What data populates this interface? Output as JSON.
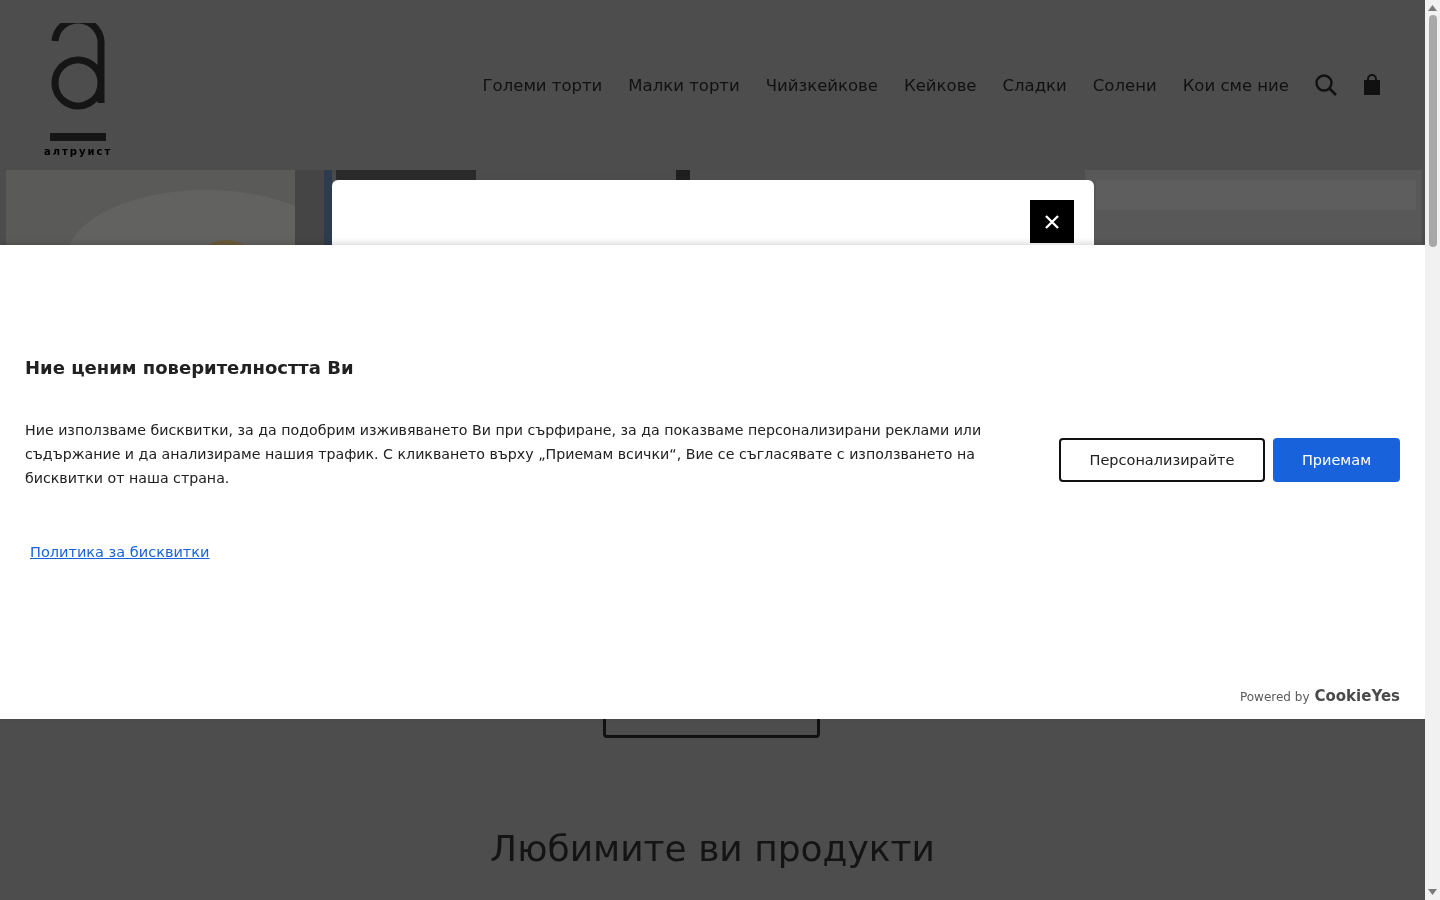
{
  "header": {
    "logo_text": "алтруист",
    "nav": [
      {
        "label": "Големи торти"
      },
      {
        "label": "Малки торти"
      },
      {
        "label": "Чийзкейкове"
      },
      {
        "label": "Кейкове"
      },
      {
        "label": "Сладки"
      },
      {
        "label": "Солени"
      },
      {
        "label": "Кои сме ние"
      }
    ]
  },
  "products_button": {
    "kind": "outline"
  },
  "section_title": "Любимите ви продукти",
  "cookie_banner": {
    "title": "Ние ценим поверителността Ви",
    "text": "Ние използваме бисквитки, за да подобрим изживяването Ви при сърфиране, за да показваме персонализирани реклами или съдържание и да анализираме нашия трафик. С кликването върху „Приемам всички“, Вие се съгласявате с използването на бисквитки от наша страна.",
    "link": "Политика за бисквитки",
    "buttons": [
      {
        "label": "Персонализирайте",
        "kind": "outline"
      },
      {
        "label": "Приемам",
        "kind": "primary"
      }
    ],
    "powered_by": "Powered by",
    "brand": "CookieYes"
  }
}
